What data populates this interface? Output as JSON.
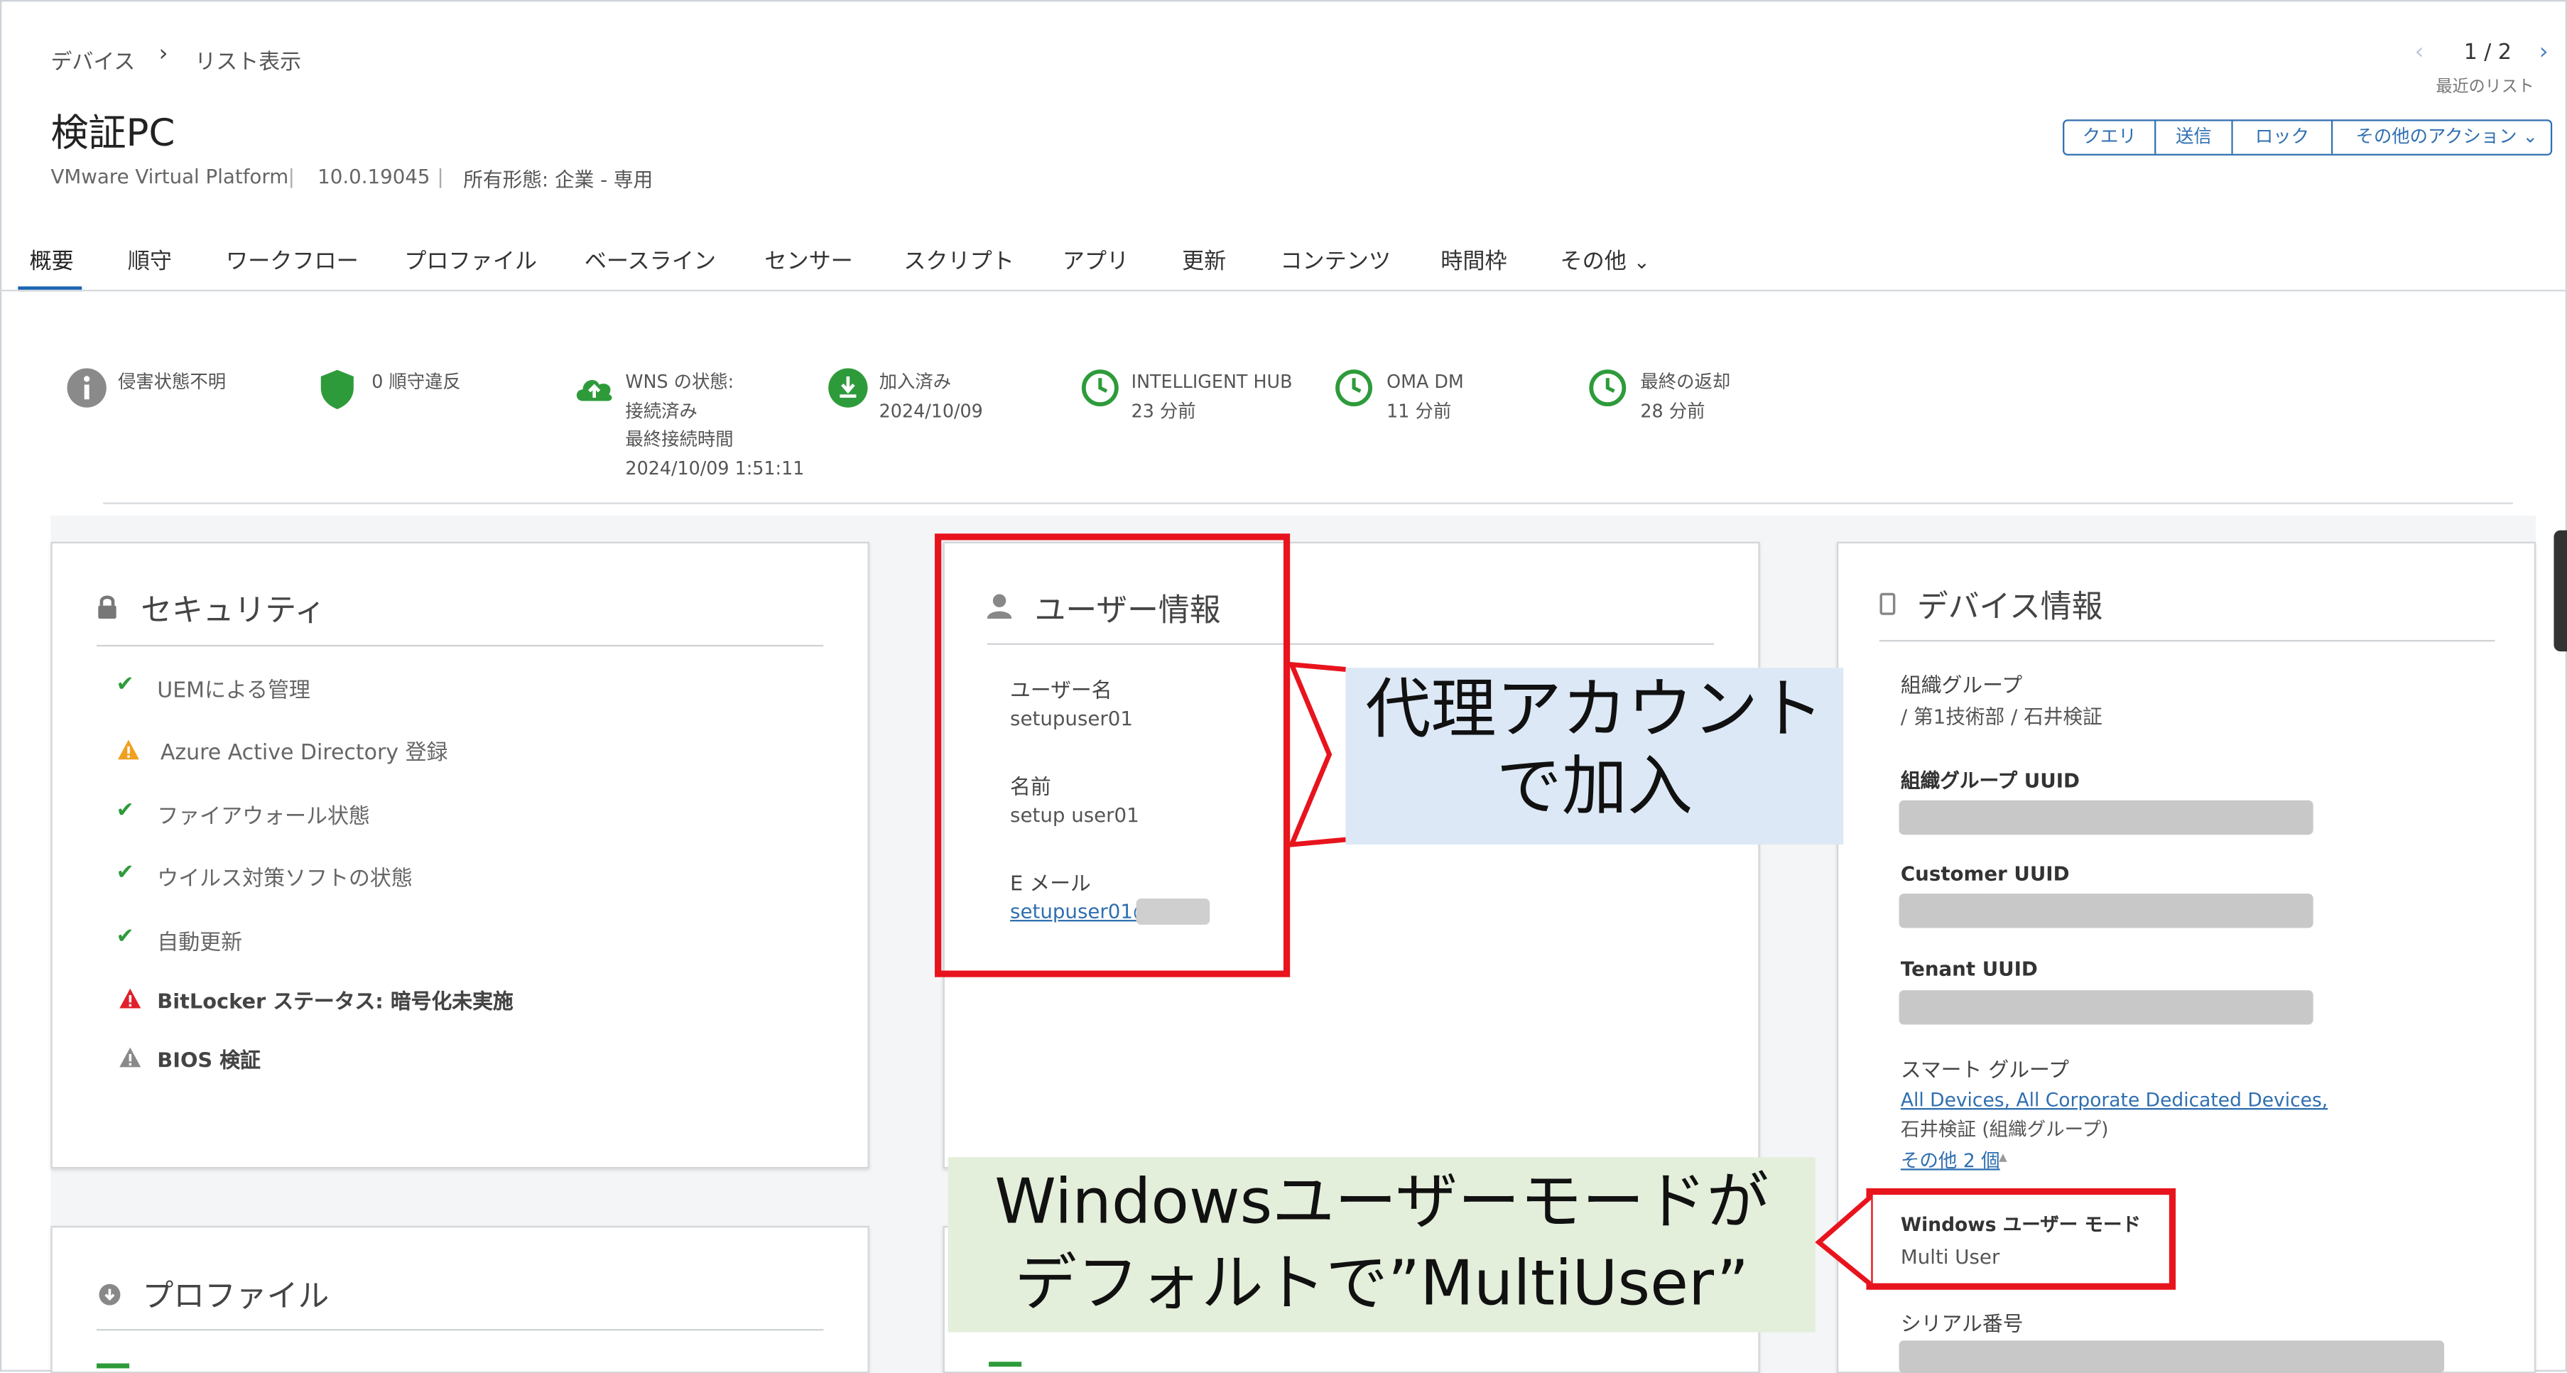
{
  "breadcrumb": {
    "parent": "デバイス",
    "current": "リスト表示"
  },
  "page_title": "検証PC",
  "subtitle": {
    "platform": "VMware Virtual Platform",
    "version": "10.0.19045",
    "ownership": "所有形態: 企業 - 専用"
  },
  "pager": {
    "position": "1 / 2",
    "label": "最近のリスト"
  },
  "actions": [
    "クエリ",
    "送信",
    "ロック",
    "その他のアクション"
  ],
  "tabs": [
    "概要",
    "順守",
    "ワークフロー",
    "プロファイル",
    "ベースライン",
    "センサー",
    "スクリプト",
    "アプリ",
    "更新",
    "コンテンツ",
    "時間枠",
    "その他"
  ],
  "status": {
    "compromised": "侵害状態不明",
    "compliance": "0 順守違反",
    "wns": {
      "l1": "WNS の状態:",
      "l2": "接続済み",
      "l3": "最終接続時間",
      "l4": "2024/10/09 1:51:11"
    },
    "enrolled": {
      "l1": "加入済み",
      "l2": "2024/10/09"
    },
    "hub": {
      "l1": "INTELLIGENT HUB",
      "l2": "23 分前"
    },
    "omadm": {
      "l1": "OMA DM",
      "l2": "11 分前"
    },
    "lastseen": {
      "l1": "最終の返却",
      "l2": "28 分前"
    }
  },
  "security": {
    "title": "セキュリティ",
    "items": [
      "UEMによる管理",
      "Azure Active Directory 登録",
      "ファイアウォール状態",
      "ウイルス対策ソフトの状態",
      "自動更新",
      "BitLocker ステータス: 暗号化未実施",
      "BIOS 検証"
    ]
  },
  "user_info": {
    "title": "ユーザー情報",
    "username_label": "ユーザー名",
    "username": "setupuser01",
    "name_label": "名前",
    "name": "setup user01",
    "email_label": "E メール",
    "email": "setupuser01@"
  },
  "device_info": {
    "title": "デバイス情報",
    "org_group_label": "組織グループ",
    "org_group": "/ 第1技術部 / 石井検証",
    "org_uuid_label": "組織グループ UUID",
    "customer_uuid_label": "Customer UUID",
    "tenant_uuid_label": "Tenant UUID",
    "smart_group_label": "スマート グループ",
    "smart_links": "All Devices, All Corporate Dedicated Devices,",
    "smart_text": "石井検証 (組織グループ)",
    "smart_more": "その他 2 個",
    "win_user_mode_label": "Windows ユーザー モード",
    "win_user_mode": "Multi User",
    "serial_label": "シリアル番号"
  },
  "profile": {
    "title": "プロファイル"
  },
  "callouts": {
    "proxy_l1": "代理アカウント",
    "proxy_l2": "で加入",
    "multi_l1": "Windowsユーザーモードが",
    "multi_l2": "デフォルトで”MultiUser”"
  },
  "colors": {
    "accent": "#1b66b3",
    "ok": "#2e9b3b",
    "warn": "#f0a020",
    "error": "#e0202a",
    "highlight_red": "#e8141d",
    "callout_blue": "#dce8f5",
    "callout_green": "#e4efdb"
  }
}
